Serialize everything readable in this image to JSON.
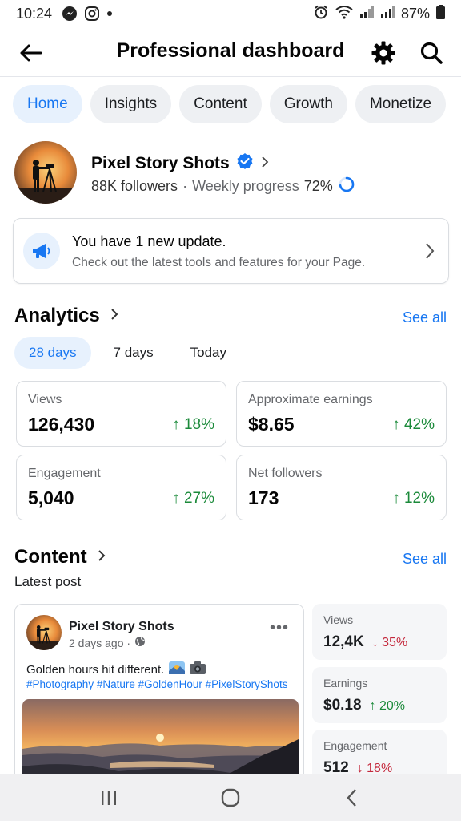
{
  "status_bar": {
    "time": "10:24",
    "battery": "87%"
  },
  "header": {
    "title": "Professional dashboard"
  },
  "tabs": [
    {
      "label": "Home",
      "active": true
    },
    {
      "label": "Insights",
      "active": false
    },
    {
      "label": "Content",
      "active": false
    },
    {
      "label": "Growth",
      "active": false
    },
    {
      "label": "Monetize",
      "active": false
    }
  ],
  "profile": {
    "name": "Pixel Story Shots",
    "followers": "88K followers",
    "separator": "·",
    "weekly_progress_label": "Weekly progress",
    "weekly_progress_value": "72%",
    "weekly_progress_fraction": 0.72
  },
  "update_card": {
    "title": "You have 1 new update.",
    "subtitle": "Check out the latest tools and features for your Page."
  },
  "analytics": {
    "title": "Analytics",
    "see_all": "See all",
    "ranges": [
      {
        "label": "28 days",
        "active": true
      },
      {
        "label": "7 days",
        "active": false
      },
      {
        "label": "Today",
        "active": false
      }
    ],
    "metrics": [
      {
        "label": "Views",
        "value": "126,430",
        "change": "↑ 18%"
      },
      {
        "label": "Approximate earnings",
        "value": "$8.65",
        "change": "↑ 42%"
      },
      {
        "label": "Engagement",
        "value": "5,040",
        "change": "↑ 27%"
      },
      {
        "label": "Net followers",
        "value": "173",
        "change": "↑ 12%"
      }
    ]
  },
  "content": {
    "title": "Content",
    "see_all": "See all",
    "subtitle": "Latest post",
    "post": {
      "author": "Pixel Story Shots",
      "time": "2 days ago ·",
      "caption": "Golden hours hit different.",
      "hashtags": "#Photography #Nature #GoldenHour #PixelStoryShots"
    },
    "stats": [
      {
        "label": "Views",
        "value": "12,4K",
        "change": "↓ 35%",
        "trend": "down"
      },
      {
        "label": "Earnings",
        "value": "$0.18",
        "change": "↑ 20%",
        "trend": "up"
      },
      {
        "label": "Engagement",
        "value": "512",
        "change": "↓ 18%",
        "trend": "down"
      }
    ]
  },
  "colors": {
    "accent": "#1877f2",
    "positive": "#1b8a3a",
    "negative": "#c4283c"
  }
}
